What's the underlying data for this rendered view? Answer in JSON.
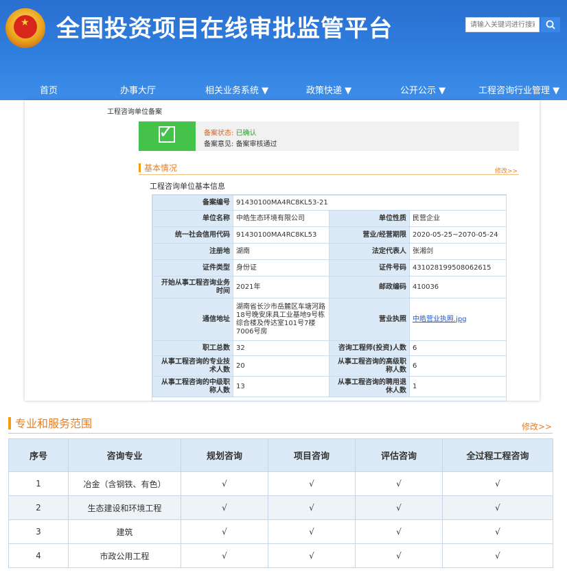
{
  "site": {
    "title": "全国投资项目在线审批监管平台"
  },
  "search": {
    "placeholder": "请输入关键词进行搜索"
  },
  "nav": [
    {
      "label": "首页"
    },
    {
      "label": "办事大厅"
    },
    {
      "label": "相关业务系统 ▼"
    },
    {
      "label": "政策快递 ▼"
    },
    {
      "label": "公开公示 ▼"
    },
    {
      "label": "工程咨询行业管理 ▼"
    }
  ],
  "breadcrumb": "工程咨询单位备案",
  "status": {
    "state_label": "备案状态:",
    "state_value": "已确认",
    "opinion_label": "备案意见:",
    "opinion_value": "备案审核通过"
  },
  "basic": {
    "title": "基本情况",
    "edit": "修改>>",
    "subtitle": "工程咨询单位基本信息"
  },
  "info": {
    "record_no_label": "备案编号",
    "record_no": "91430100MA4RC8KL53-21",
    "name_label": "单位名称",
    "name": "中皓生态环境有限公司",
    "nature_label": "单位性质",
    "nature": "民营企业",
    "credit_label": "统一社会信用代码",
    "credit": "91430100MA4RC8KL53",
    "period_label": "营业/经营期限",
    "period": "2020-05-25~2070-05-24",
    "reg_label": "注册地",
    "reg": "湖南",
    "legal_label": "法定代表人",
    "legal": "张湘剑",
    "cert_type_label": "证件类型",
    "cert_type": "身份证",
    "cert_no_label": "证件号码",
    "cert_no": "431028199508062615",
    "start_label": "开始从事工程咨询业务时间",
    "start": "2021年",
    "zip_label": "邮政编码",
    "zip": "410036",
    "addr_label": "通信地址",
    "addr": "湖南省长沙市岳麓区车塘河路18号晚安床具工业基地9号栋综合楼及传达室101号7楼7006号房",
    "license_label": "营业执照",
    "license": "中皓营业执照.jpg",
    "staff_label": "职工总数",
    "staff": "32",
    "engineers_label": "咨询工程师(投资)人数",
    "engineers": "6",
    "tech_label": "从事工程咨询的专业技术人数",
    "tech": "20",
    "senior_label": "从事工程咨询的高级职称人数",
    "senior": "6",
    "mid_label": "从事工程咨询的中级职称人数",
    "mid": "13",
    "retired_label": "从事工程咨询的聘用退休人数",
    "retired": "1"
  },
  "scope": {
    "title": "专业和服务范围",
    "edit": "修改>>",
    "headers": [
      "序号",
      "咨询专业",
      "规划咨询",
      "项目咨询",
      "评估咨询",
      "全过程工程咨询"
    ],
    "rows": [
      {
        "no": "1",
        "major": "冶金（含钢铁、有色）",
        "c1": "√",
        "c2": "√",
        "c3": "√",
        "c4": "√"
      },
      {
        "no": "2",
        "major": "生态建设和环境工程",
        "c1": "√",
        "c2": "√",
        "c3": "√",
        "c4": "√"
      },
      {
        "no": "3",
        "major": "建筑",
        "c1": "√",
        "c2": "√",
        "c3": "√",
        "c4": "√"
      },
      {
        "no": "4",
        "major": "市政公用工程",
        "c1": "√",
        "c2": "√",
        "c3": "√",
        "c4": "√"
      }
    ]
  }
}
